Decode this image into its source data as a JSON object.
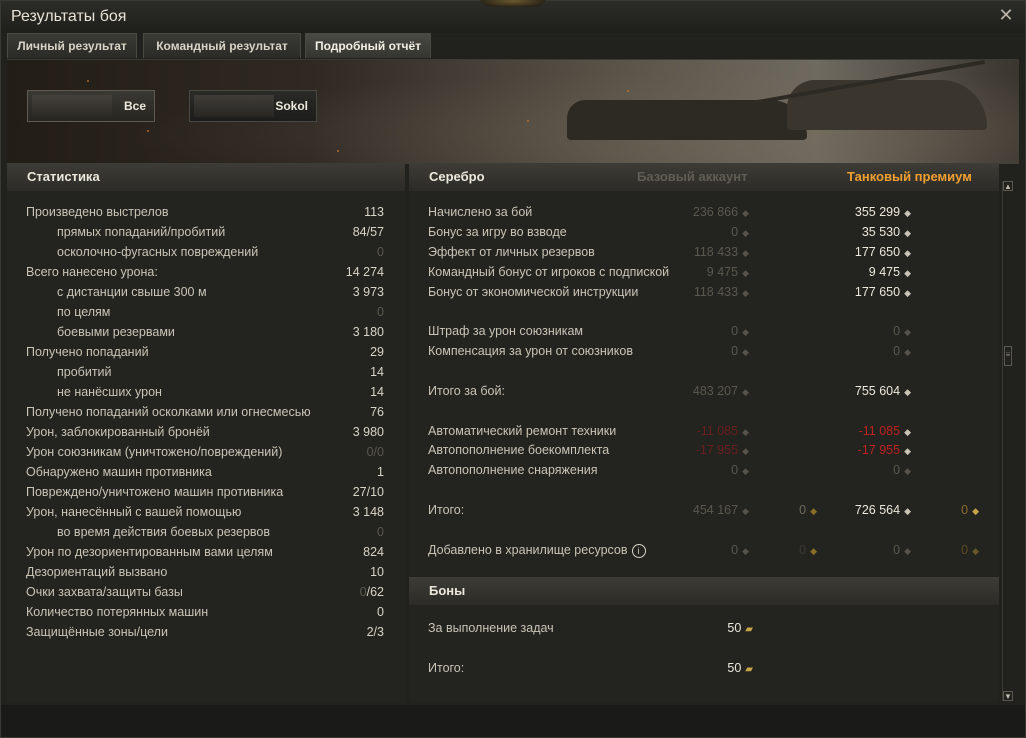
{
  "window": {
    "title": "Результаты боя"
  },
  "tabs": [
    {
      "label": "Личный результат"
    },
    {
      "label": "Командный результат"
    },
    {
      "label": "Подробный отчёт"
    }
  ],
  "vehicles": [
    {
      "label": "Все"
    },
    {
      "label": "Sokol"
    }
  ],
  "stats": {
    "header": "Статистика",
    "rows": [
      {
        "label": "Произведено выстрелов",
        "value": "113",
        "indent": false,
        "dim": false
      },
      {
        "label": "прямых попаданий/пробитий",
        "value": "84/57",
        "indent": true,
        "dim": false
      },
      {
        "label": "осколочно-фугасных повреждений",
        "value": "0",
        "indent": true,
        "dim": true
      },
      {
        "label": "Всего нанесено урона:",
        "value": "14 274",
        "indent": false,
        "dim": false
      },
      {
        "label": "с дистанции свыше 300 м",
        "value": "3 973",
        "indent": true,
        "dim": false
      },
      {
        "label": "по целям",
        "value": "0",
        "indent": true,
        "dim": true
      },
      {
        "label": "боевыми резервами",
        "value": "3 180",
        "indent": true,
        "dim": false
      },
      {
        "label": "Получено попаданий",
        "value": "29",
        "indent": false,
        "dim": false
      },
      {
        "label": "пробитий",
        "value": "14",
        "indent": true,
        "dim": false
      },
      {
        "label": "не нанёсших урон",
        "value": "14",
        "indent": true,
        "dim": false
      },
      {
        "label": "Получено попаданий осколками или огнесмесью",
        "value": "76",
        "indent": false,
        "dim": false
      },
      {
        "label": "Урон, заблокированный бронёй",
        "value": "3 980",
        "indent": false,
        "dim": false
      },
      {
        "label": "Урон союзникам (уничтожено/повреждений)",
        "value": "0/0",
        "indent": false,
        "dim": true
      },
      {
        "label": "Обнаружено машин противника",
        "value": "1",
        "indent": false,
        "dim": false
      },
      {
        "label": "Повреждено/уничтожено машин противника",
        "value": "27/10",
        "indent": false,
        "dim": false
      },
      {
        "label": "Урон, нанесённый с вашей помощью",
        "value": "3 148",
        "indent": false,
        "dim": false
      },
      {
        "label": "во время действия боевых резервов",
        "value": "0",
        "indent": true,
        "dim": true
      },
      {
        "label": "Урон по дезориентированным вами целям",
        "value": "824",
        "indent": false,
        "dim": false
      },
      {
        "label": "Дезориентаций вызвано",
        "value": "10",
        "indent": false,
        "dim": false
      },
      {
        "label": "Очки захвата/защиты базы",
        "value_dim": "0",
        "value": "/62",
        "indent": false,
        "dim": false
      },
      {
        "label": "Количество потерянных машин",
        "value": "0",
        "indent": false,
        "dim": false
      },
      {
        "label": "Защищённые зоны/цели",
        "value": "2/3",
        "indent": false,
        "dim": false
      }
    ]
  },
  "silver": {
    "header": "Серебро",
    "col_base": "Базовый аккаунт",
    "col_premium": "Танковый премиум",
    "rows": [
      {
        "label": "Начислено за бой",
        "base": "236 866",
        "premium": "355 299"
      },
      {
        "label": "Бонус за игру во взводе",
        "base": "0",
        "premium": "35 530"
      },
      {
        "label": "Эффект от личных резервов",
        "base": "118 433",
        "premium": "177 650"
      },
      {
        "label": "Командный бонус от игроков с подпиской",
        "base": "9 475",
        "premium": "9 475"
      },
      {
        "label": "Бонус от экономической инструкции",
        "base": "118 433",
        "premium": "177 650"
      },
      {
        "label": "Штраф за урон союзникам",
        "base": "0",
        "premium": "0"
      },
      {
        "label": "Компенсация за урон от союзников",
        "base": "0",
        "premium": "0"
      },
      {
        "label": "Итого за бой:",
        "base": "483 207",
        "premium": "755 604"
      },
      {
        "label": "Автоматический ремонт техники",
        "base": "-11 085",
        "premium": "-11 085"
      },
      {
        "label": "Автопополнение боекомплекта",
        "base": "-17 955",
        "premium": "-17 955"
      },
      {
        "label": "Автопополнение снаряжения",
        "base": "0",
        "premium": "0"
      },
      {
        "label": "Итого:",
        "base": "454 167",
        "base_gold": "0",
        "premium": "726 564",
        "premium_gold": "0"
      },
      {
        "label": "Добавлено в хранилище ресурсов",
        "base": "0",
        "base_gold": "0",
        "premium": "0",
        "premium_gold": "0"
      }
    ]
  },
  "bonds": {
    "header": "Боны",
    "rows": [
      {
        "label": "За выполнение задач",
        "value": "50"
      },
      {
        "label": "Итого:",
        "value": "50"
      }
    ]
  },
  "icons": {
    "close": "close-icon",
    "silver": "silver-coin-icon",
    "gold": "gold-icon",
    "bonds": "bonds-icon",
    "info": "info-icon"
  },
  "colors": {
    "premium_header": "#f0a030",
    "negative": "#c02020",
    "base_header": "#5f5d55"
  }
}
